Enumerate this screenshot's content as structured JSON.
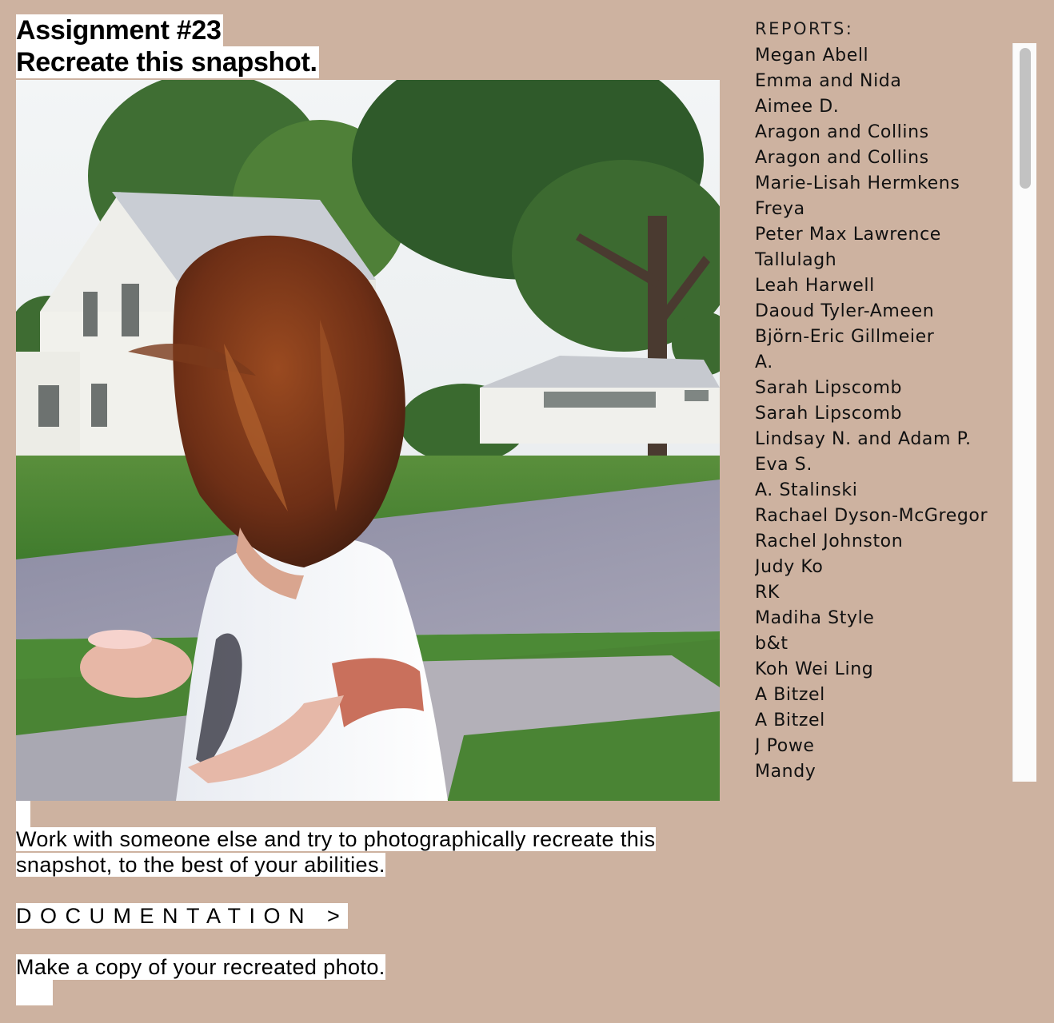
{
  "assignment": {
    "number_line": "Assignment #23",
    "title_line": "Recreate this snapshot."
  },
  "photo": {
    "subject": "snapshot-photo",
    "colors": {
      "sky": "#eef2f4",
      "grass": "#4f8a3a",
      "road": "#8f8fa3",
      "house": "#f2f2ee",
      "hair": "#7a3a1c",
      "shirt": "#f4f4f6"
    }
  },
  "description": {
    "text": "Work with someone else and try to photographically recreate this snapshot, to the best of your abilities."
  },
  "documentation_link": {
    "label": "DOCUMENTATION >"
  },
  "copy_instruction": {
    "text": "Make a copy of your recreated photo."
  },
  "reports": {
    "heading": "REPORTS:",
    "items": [
      "Megan Abell",
      "Emma and Nida",
      "Aimee D.",
      "Aragon and Collins",
      "Aragon and Collins",
      "Marie-Lisah Hermkens",
      "Freya",
      "Peter Max Lawrence",
      "Tallulagh",
      "Leah Harwell",
      "Daoud Tyler-Ameen",
      "Björn-Eric Gillmeier",
      "A.",
      "Sarah Lipscomb",
      "Sarah Lipscomb",
      "Lindsay N. and Adam P.",
      "Eva S.",
      "A. Stalinski",
      "Rachael Dyson-McGregor",
      "Rachel Johnston",
      "Judy Ko",
      "RK",
      "Madiha Style",
      "b&t",
      "Koh Wei Ling",
      "A Bitzel",
      "A Bitzel",
      "J Powe",
      "Mandy"
    ]
  },
  "colors": {
    "page_background": "#cdb2a0",
    "highlight": "#ffffff",
    "text": "#000000"
  }
}
